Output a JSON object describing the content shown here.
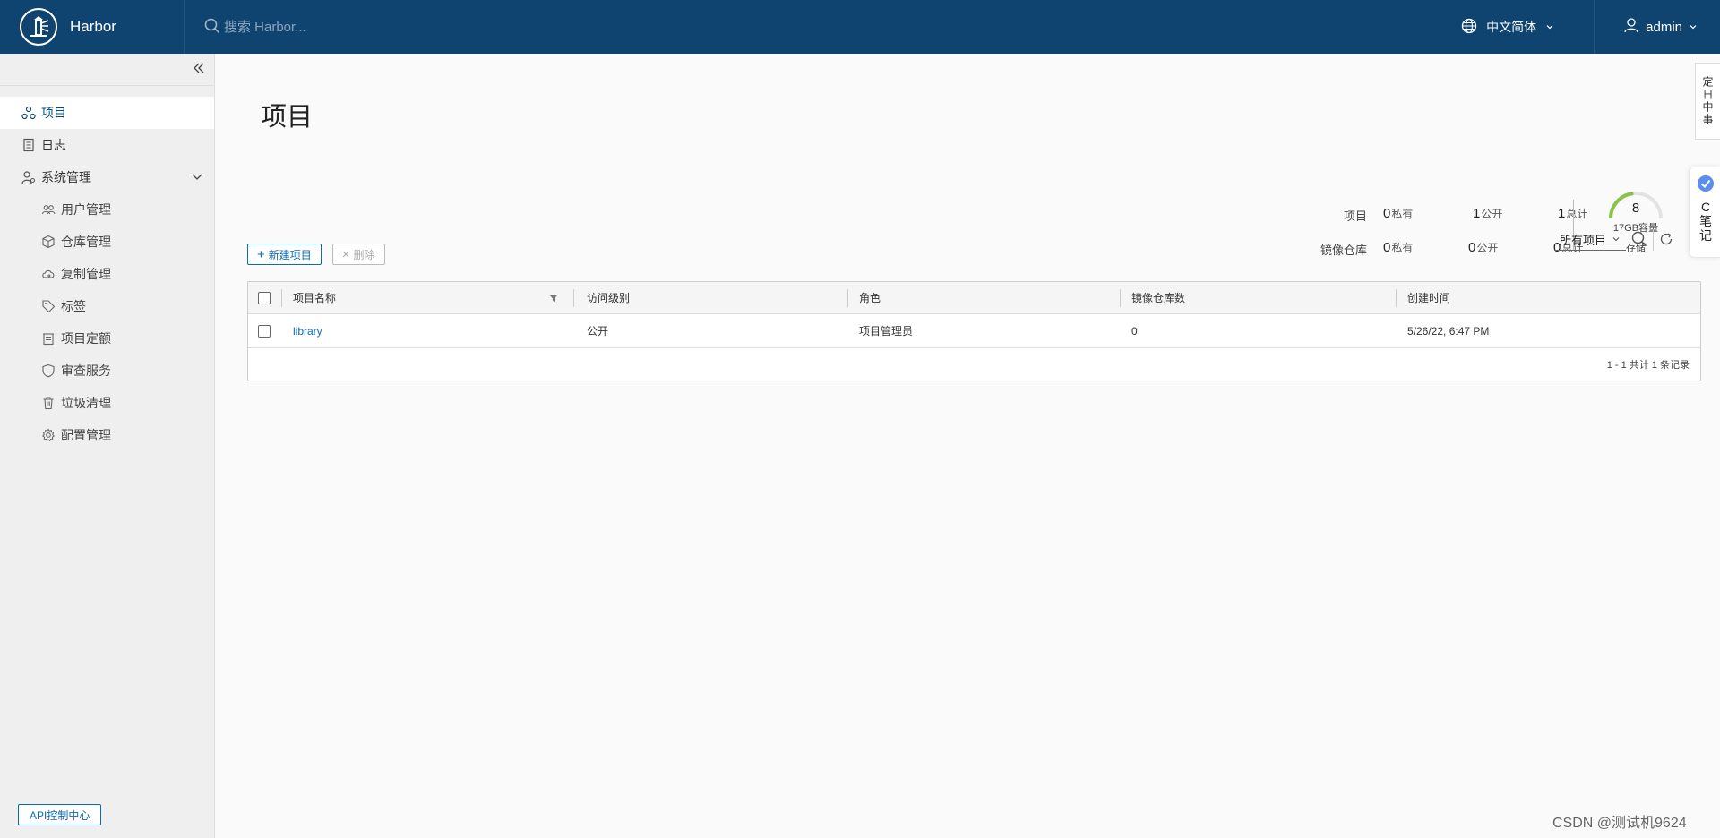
{
  "header": {
    "app_name": "Harbor",
    "search_placeholder": "搜索 Harbor...",
    "language": "中文简体",
    "user": "admin"
  },
  "sidebar": {
    "items": [
      {
        "label": "项目",
        "icon": "projects-icon"
      },
      {
        "label": "日志",
        "icon": "log-icon"
      },
      {
        "label": "系统管理",
        "icon": "admin-icon"
      }
    ],
    "sub_items": [
      {
        "label": "用户管理",
        "icon": "users-icon"
      },
      {
        "label": "仓库管理",
        "icon": "registry-icon"
      },
      {
        "label": "复制管理",
        "icon": "replication-icon"
      },
      {
        "label": "标签",
        "icon": "tag-icon"
      },
      {
        "label": "项目定额",
        "icon": "quota-icon"
      },
      {
        "label": "审查服务",
        "icon": "shield-icon"
      },
      {
        "label": "垃圾清理",
        "icon": "trash-icon"
      },
      {
        "label": "配置管理",
        "icon": "gear-icon"
      }
    ],
    "api_button": "API控制中心"
  },
  "main": {
    "title": "项目",
    "stats": {
      "projects_label": "项目",
      "repos_label": "镜像仓库",
      "projects_private": "0",
      "projects_public": "1",
      "projects_total": "1",
      "repos_private": "0",
      "repos_public": "0",
      "repos_total": "0",
      "private_label": "私有",
      "public_label": "公开",
      "total_label": "总计"
    },
    "storage": {
      "value": "8",
      "capacity": "17GB容量",
      "label": "存储",
      "fill_fraction": 0.47,
      "fill_color": "#8bc34a"
    },
    "toolbar": {
      "new_project": "新建项目",
      "delete": "删除"
    },
    "filter": {
      "selected": "所有项目"
    },
    "table": {
      "columns": [
        "项目名称",
        "访问级别",
        "角色",
        "镜像仓库数",
        "创建时间"
      ],
      "rows": [
        {
          "name": "library",
          "access": "公开",
          "role": "项目管理员",
          "repos": "0",
          "created": "5/26/22, 6:47 PM"
        }
      ],
      "footer": "1 - 1 共计 1 条记录"
    }
  },
  "floats": {
    "tab_text": "定日中事",
    "note_text": "C笔记"
  },
  "watermark": "CSDN @测试机9624"
}
